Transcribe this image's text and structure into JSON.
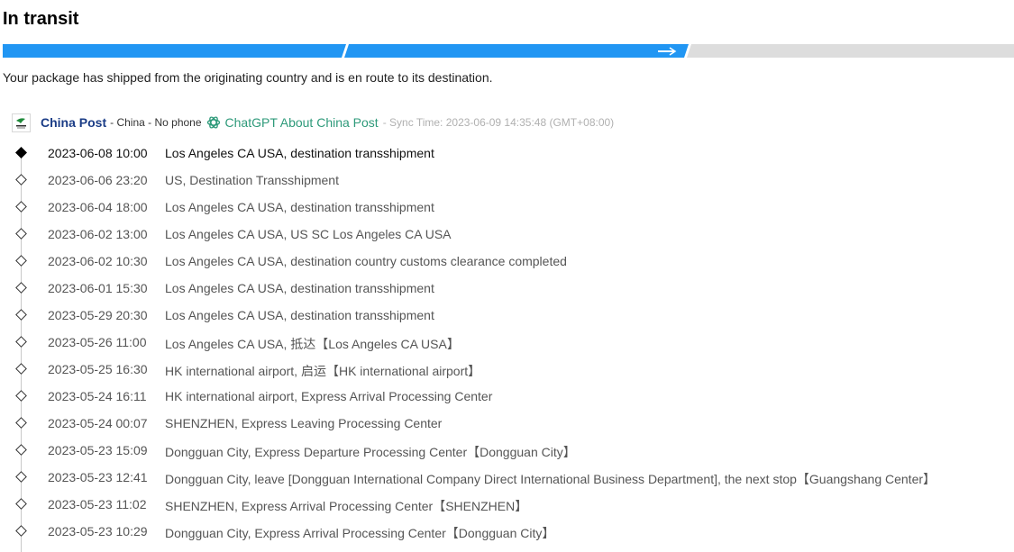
{
  "status": {
    "title": "In transit",
    "description": "Your package has shipped from the originating country and is en route to its destination.",
    "progress_segments_completed": 2,
    "progress_segments_total": 3
  },
  "colors": {
    "progress_active": "#2196f3",
    "progress_inactive": "#dddddd",
    "carrier_name": "#1a3c86",
    "chatgpt_link": "#2e9a7a"
  },
  "carrier": {
    "name": "China Post",
    "meta": "- China - No phone",
    "chatgpt_link": "ChatGPT About China Post",
    "sync_time": "- Sync Time: 2023-06-09 14:35:48 (GMT+08:00)",
    "logo_icon": "china-post-logo",
    "chatgpt_icon": "openai-icon"
  },
  "events": [
    {
      "time": "2023-06-08 10:00",
      "desc": "Los Angeles CA USA, destination transshipment"
    },
    {
      "time": "2023-06-06 23:20",
      "desc": "US, Destination Transshipment"
    },
    {
      "time": "2023-06-04 18:00",
      "desc": "Los Angeles CA USA, destination transshipment"
    },
    {
      "time": "2023-06-02 13:00",
      "desc": "Los Angeles CA USA, US SC Los Angeles CA USA"
    },
    {
      "time": "2023-06-02 10:30",
      "desc": "Los Angeles CA USA, destination country customs clearance completed"
    },
    {
      "time": "2023-06-01 15:30",
      "desc": "Los Angeles CA USA, destination transshipment"
    },
    {
      "time": "2023-05-29 20:30",
      "desc": "Los Angeles CA USA, destination transshipment"
    },
    {
      "time": "2023-05-26 11:00",
      "desc": "Los Angeles CA USA, 抵达【Los Angeles CA USA】"
    },
    {
      "time": "2023-05-25 16:30",
      "desc": "HK international airport, 启运【HK international airport】"
    },
    {
      "time": "2023-05-24 16:11",
      "desc": "HK international airport, Express Arrival Processing Center"
    },
    {
      "time": "2023-05-24 00:07",
      "desc": "SHENZHEN, Express Leaving Processing Center"
    },
    {
      "time": "2023-05-23 15:09",
      "desc": "Dongguan City, Express Departure Processing Center【Dongguan City】"
    },
    {
      "time": "2023-05-23 12:41",
      "desc": "Dongguan City, leave [Dongguan International Company Direct International Business Department], the next stop【Guangshang Center】"
    },
    {
      "time": "2023-05-23 11:02",
      "desc": "SHENZHEN, Express Arrival Processing Center【SHENZHEN】"
    },
    {
      "time": "2023-05-23 10:29",
      "desc": "Dongguan City, Express Arrival Processing Center【Dongguan City】"
    }
  ]
}
